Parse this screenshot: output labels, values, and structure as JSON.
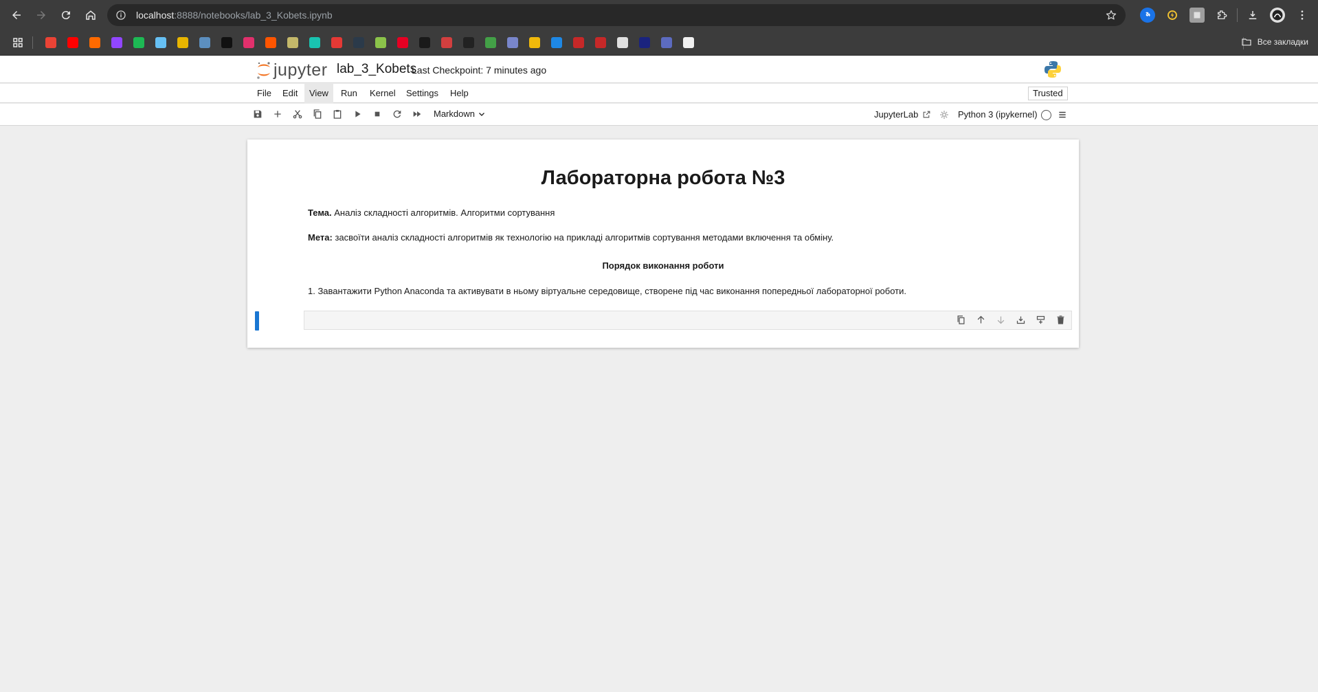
{
  "browser": {
    "url_host": "localhost",
    "url_rest": ":8888/notebooks/lab_3_Kobets.ipynb",
    "bookmarks_folder": "Все закладки",
    "bookmark_icons": [
      {
        "name": "gmail-bookmark-icon",
        "color": "#ea4335"
      },
      {
        "name": "youtube-bookmark-icon",
        "color": "#ff0000"
      },
      {
        "name": "bookmark-icon-3",
        "color": "#ff6a00"
      },
      {
        "name": "twitch-bookmark-icon",
        "color": "#9146ff"
      },
      {
        "name": "spotify-bookmark-icon",
        "color": "#1db954"
      },
      {
        "name": "steam-bookmark-icon",
        "color": "#66c0f4"
      },
      {
        "name": "bookmark-icon-7",
        "color": "#e8b500"
      },
      {
        "name": "bookmark-icon-8",
        "color": "#5c8fbf"
      },
      {
        "name": "tiktok-bookmark-icon",
        "color": "#111111"
      },
      {
        "name": "instagram-bookmark-icon",
        "color": "#e1306c"
      },
      {
        "name": "soundcloud-bookmark-icon",
        "color": "#ff5500"
      },
      {
        "name": "bookmark-icon-12",
        "color": "#c4b86a"
      },
      {
        "name": "bookmark-icon-13",
        "color": "#19c3b0"
      },
      {
        "name": "bookmark-icon-14",
        "color": "#e53935"
      },
      {
        "name": "bookmark-icon-15",
        "color": "#2b3a4a"
      },
      {
        "name": "bookmark-icon-16",
        "color": "#8bc34a"
      },
      {
        "name": "pinterest-bookmark-icon",
        "color": "#e60023"
      },
      {
        "name": "openai-bookmark-icon",
        "color": "#1a1a1a"
      },
      {
        "name": "bookmark-icon-19",
        "color": "#d23f3f"
      },
      {
        "name": "bookmark-icon-20",
        "color": "#222222"
      },
      {
        "name": "bookmark-icon-21",
        "color": "#43a047"
      },
      {
        "name": "bookmark-icon-22",
        "color": "#7986cb"
      },
      {
        "name": "binance-bookmark-icon",
        "color": "#f0b90b"
      },
      {
        "name": "bookmark-icon-24",
        "color": "#1e88e5"
      },
      {
        "name": "bookmark-icon-25",
        "color": "#c62828"
      },
      {
        "name": "bookmark-icon-26",
        "color": "#c62828"
      },
      {
        "name": "bookmark-icon-27",
        "color": "#e0e0e0"
      },
      {
        "name": "bookmark-icon-28",
        "color": "#1a237e"
      },
      {
        "name": "bookmark-icon-29",
        "color": "#5c6bc0"
      },
      {
        "name": "github-bookmark-icon",
        "color": "#f0f0f0"
      }
    ]
  },
  "jupyter": {
    "logo_text": "jupyter",
    "notebook_title": "lab_3_Kobets",
    "checkpoint": "Last Checkpoint: 7 minutes ago",
    "menu": [
      "File",
      "Edit",
      "View",
      "Run",
      "Kernel",
      "Settings",
      "Help"
    ],
    "active_menu": "View",
    "trusted": "Trusted",
    "cell_type": "Markdown",
    "jupyterlab_link": "JupyterLab",
    "kernel_name": "Python 3 (ipykernel)"
  },
  "notebook": {
    "heading": "Лабораторна робота №3",
    "topic_label": "Тема.",
    "topic_text": " Аналіз складності алгоритмів. Алгоритми сортування",
    "goal_label": "Мета:",
    "goal_text": " засвоїти аналіз складності алгоритмів як технологію на прикладі алгоритмів сортування методами включення та обміну.",
    "procedure_heading": "Порядок виконання роботи",
    "step_1": "1. Завантажити Python Anaconda та активувати в ньому віртуальне середовище, створене під час виконання попередньої лабораторної роботи."
  },
  "colors": {
    "accent_blue": "#1976d2",
    "jupyter_orange": "#f37626"
  }
}
